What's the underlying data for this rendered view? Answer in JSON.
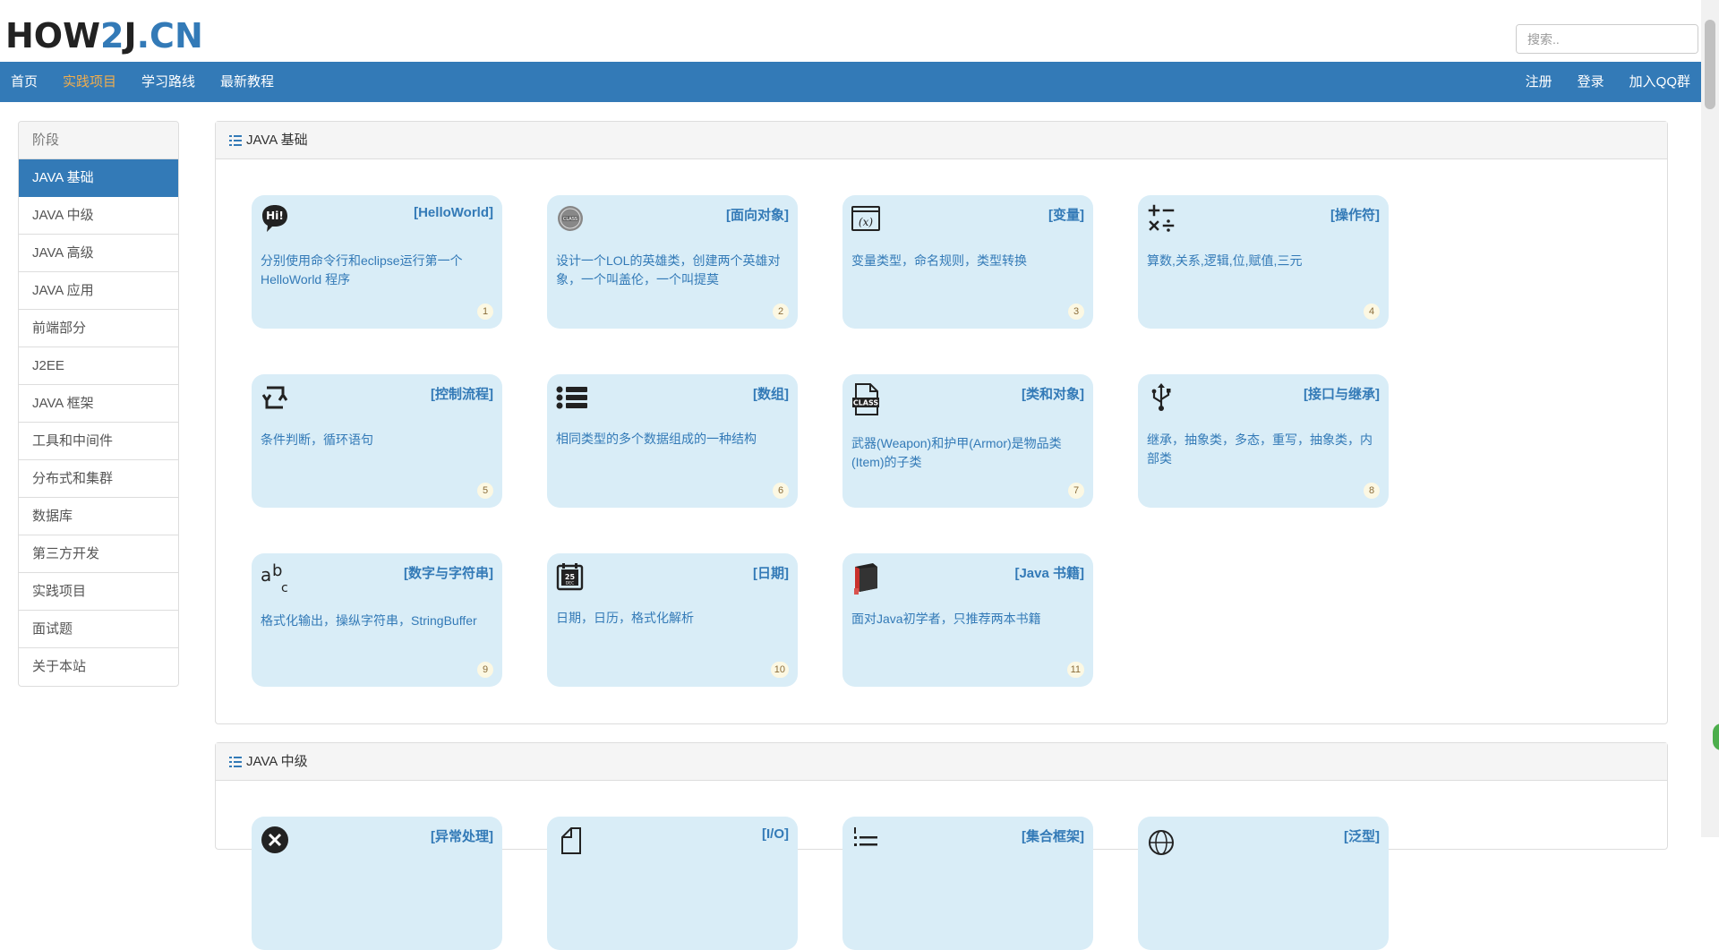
{
  "header": {
    "logo_main": "HOW",
    "logo_accent": "2J",
    "logo_tail": "J",
    "logo_domain": ".CN",
    "search_placeholder": "搜索.."
  },
  "nav": {
    "left": [
      "首页",
      "实践项目",
      "学习路线",
      "最新教程"
    ],
    "active": "实践项目",
    "right": [
      "注册",
      "登录",
      "加入QQ群"
    ]
  },
  "sidebar": {
    "heading": "阶段",
    "items": [
      "JAVA 基础",
      "JAVA 中级",
      "JAVA 高级",
      "JAVA 应用",
      "前端部分",
      "J2EE",
      "JAVA 框架",
      "工具和中间件",
      "分布式和集群",
      "数据库",
      "第三方开发",
      "实践项目",
      "面试题",
      "关于本站"
    ],
    "active": "JAVA 基础"
  },
  "sections": [
    {
      "title": "JAVA 基础",
      "cards": [
        {
          "title": "[HelloWorld]",
          "desc": "分别使用命令行和eclipse运行第一个HelloWorld 程序",
          "num": "1",
          "icon": "hi-speech-icon"
        },
        {
          "title": "[面向对象]",
          "desc": "设计一个LOL的英雄类，创建两个英雄对象，一个叫盖伦，一个叫提莫",
          "num": "2",
          "icon": "object-badge-icon"
        },
        {
          "title": "[变量]",
          "desc": "变量类型，命名规则，类型转换",
          "num": "3",
          "icon": "variable-x-icon"
        },
        {
          "title": "[操作符]",
          "desc": "算数,关系,逻辑,位,赋值,三元",
          "num": "4",
          "icon": "operators-icon"
        },
        {
          "title": "[控制流程]",
          "desc": "条件判断，循环语句",
          "num": "5",
          "icon": "loop-arrows-icon"
        },
        {
          "title": "[数组]",
          "desc": "相同类型的多个数据组成的一种结构",
          "num": "6",
          "icon": "list-icon"
        },
        {
          "title": "[类和对象]",
          "desc": "武器(Weapon)和护甲(Armor)是物品类(Item)的子类",
          "num": "7",
          "icon": "class-file-icon"
        },
        {
          "title": "[接口与继承]",
          "desc": "继承，抽象类，多态，重写，抽象类，内部类",
          "num": "8",
          "icon": "usb-icon"
        },
        {
          "title": "[数字与字符串]",
          "desc": "格式化输出，操纵字符串，StringBuffer",
          "num": "9",
          "icon": "abc-icon"
        },
        {
          "title": "[日期]",
          "desc": "日期，日历，格式化解析",
          "num": "10",
          "icon": "calendar-icon"
        },
        {
          "title": "[Java 书籍]",
          "desc": "面对Java初学者，只推荐两本书籍",
          "num": "11",
          "icon": "book-icon"
        }
      ]
    },
    {
      "title": "JAVA 中级",
      "cards": [
        {
          "title": "[异常处理]",
          "icon": "error-icon"
        },
        {
          "title": "[I/O]",
          "icon": "file-icon"
        },
        {
          "title": "[集合框架]",
          "icon": "collection-icon"
        },
        {
          "title": "[泛型]",
          "icon": "globe-icon"
        }
      ]
    }
  ],
  "colors": {
    "primary": "#337ab7",
    "active_nav": "#f0ad4e",
    "card_bg": "#d9edf7",
    "badge_bg": "#fcf8e3"
  }
}
